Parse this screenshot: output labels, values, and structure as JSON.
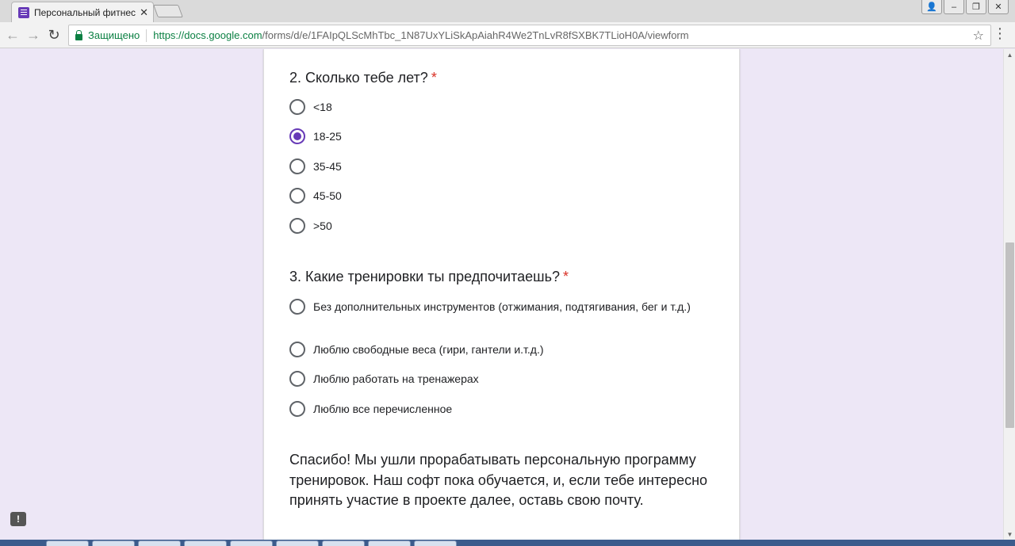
{
  "browser": {
    "tab_title": "Персональный фитнес",
    "tab_close": "✕",
    "window_controls": [
      "👤",
      "–",
      "❐",
      "✕"
    ],
    "nav": {
      "back": "←",
      "forward": "→",
      "reload": "↻"
    },
    "secure_label": "Защищено",
    "url_host": "https://docs.google.com",
    "url_path": "/forms/d/e/1FAIpQLScMhTbc_1N87UxYLiSkApAiahR4We2TnLvR8fSXBK7TLioH0A/viewform",
    "star": "☆",
    "menu": "⋮"
  },
  "form": {
    "q2": {
      "title": "2. Сколько тебе лет?",
      "required": "*",
      "options": [
        "<18",
        "18-25",
        "35-45",
        "45-50",
        ">50"
      ],
      "selected_index": 1
    },
    "q3": {
      "title": "3. Какие тренировки ты предпочитаешь?",
      "required": "*",
      "options": [
        "Без дополнительных инструментов (отжимания, подтягивания, бег и т.д.)",
        "Люблю свободные веса (гири, гантели и.т.д.)",
        "Люблю работать на тренажерах",
        "Люблю все перечисленное"
      ]
    },
    "thanks_text": "Спасибо! Мы ушли прорабатывать персональную программу тренировок. Наш софт пока обучается, и, если тебе интересно принять участие в проекте далее, оставь свою почту."
  },
  "feedback": "!",
  "scrollbar": {
    "up": "▲",
    "down": "▼"
  },
  "colors": {
    "accent": "#673ab7",
    "required": "#d93025",
    "secure": "#0b8043",
    "page_bg": "#ede7f6"
  }
}
